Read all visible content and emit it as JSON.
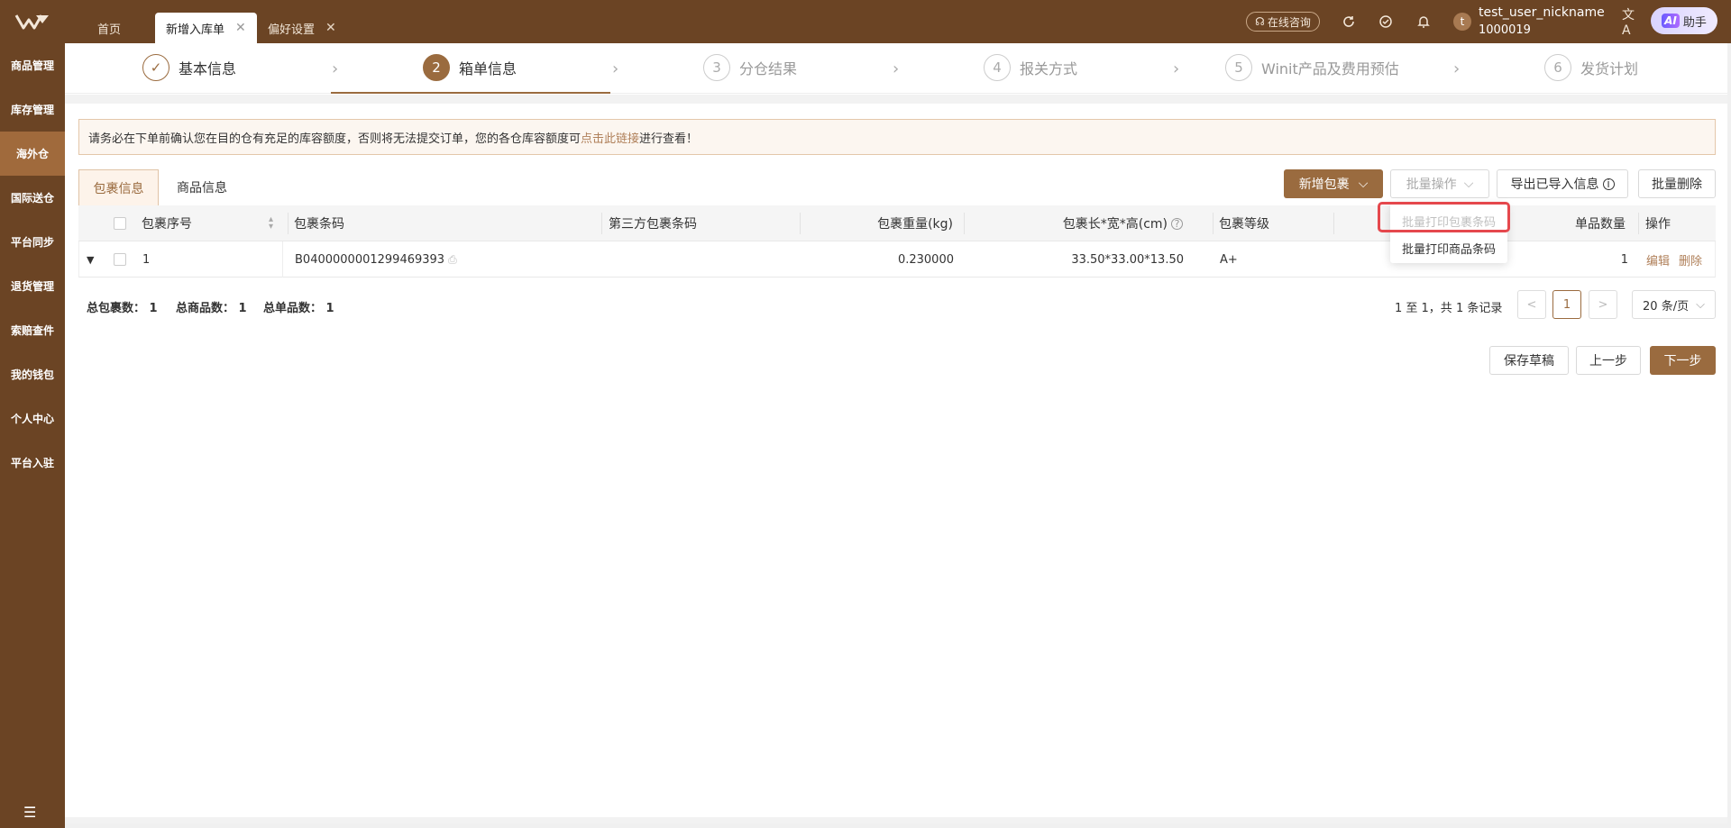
{
  "topbar": {
    "tabs": [
      {
        "label": "首页",
        "active": false
      },
      {
        "label": "新增入库单",
        "active": true
      },
      {
        "label": "偏好设置",
        "active": false
      }
    ],
    "consult_label": "在线咨询",
    "user_avatar": "t",
    "user_name": "test_user_nickname",
    "user_id": "1000019",
    "ai_badge": "AI",
    "ai_label": "助手"
  },
  "sidebar": {
    "items": [
      "商品管理",
      "库存管理",
      "海外仓",
      "国际送仓",
      "平台同步",
      "退货管理",
      "索赔查件",
      "我的钱包",
      "个人中心",
      "平台入驻"
    ],
    "active_index": 2
  },
  "steps": [
    {
      "num": "✓",
      "label": "基本信息",
      "state": "done"
    },
    {
      "num": "2",
      "label": "箱单信息",
      "state": "current"
    },
    {
      "num": "3",
      "label": "分仓结果",
      "state": "todo"
    },
    {
      "num": "4",
      "label": "报关方式",
      "state": "todo"
    },
    {
      "num": "5",
      "label": "Winit产品及费用预估",
      "state": "todo"
    },
    {
      "num": "6",
      "label": "发货计划",
      "state": "todo"
    }
  ],
  "alert": {
    "prefix": "请务必在下单前确认您在目的仓有充足的库容额度，否则将无法提交订单，您的各仓库容额度可",
    "link": "点击此链接",
    "suffix": "进行查看！"
  },
  "panel_tabs": [
    "包裹信息",
    "商品信息"
  ],
  "toolbar": {
    "add_package": "新增包裹",
    "batch_ops": "批量操作",
    "export": "导出已导入信息",
    "batch_delete": "批量删除"
  },
  "dropdown": {
    "items": [
      {
        "label": "批量打印包裹条码",
        "disabled": true
      },
      {
        "label": "批量打印商品条码",
        "disabled": false
      }
    ]
  },
  "table": {
    "headers": {
      "seq": "包裹序号",
      "barcode": "包裹条码",
      "third_barcode": "第三方包裹条码",
      "weight": "包裹重量(kg)",
      "dims": "包裹长*宽*高(cm)",
      "grade": "包裹等级",
      "qty": "单品数量",
      "ops": "操作"
    },
    "rows": [
      {
        "seq": "1",
        "barcode": "B0400000001299469393",
        "third_barcode": "",
        "weight": "0.230000",
        "dims": "33.50*33.00*13.50",
        "grade": "A+",
        "qty": "1",
        "edit": "编辑",
        "delete": "删除"
      }
    ]
  },
  "summary": {
    "packages": "总包裹数： 1",
    "goods": "总商品数： 1",
    "items": "总单品数： 1"
  },
  "pager": {
    "text": "1 至 1，共 1 条记录",
    "prev": "<",
    "current": "1",
    "next": ">",
    "page_size": "20 条/页"
  },
  "footer": {
    "save_draft": "保存草稿",
    "prev_step": "上一步",
    "next_step": "下一步"
  },
  "colors": {
    "brand": "#6b4424",
    "accent": "#9a6b3f",
    "highlight": "#e5484d"
  }
}
